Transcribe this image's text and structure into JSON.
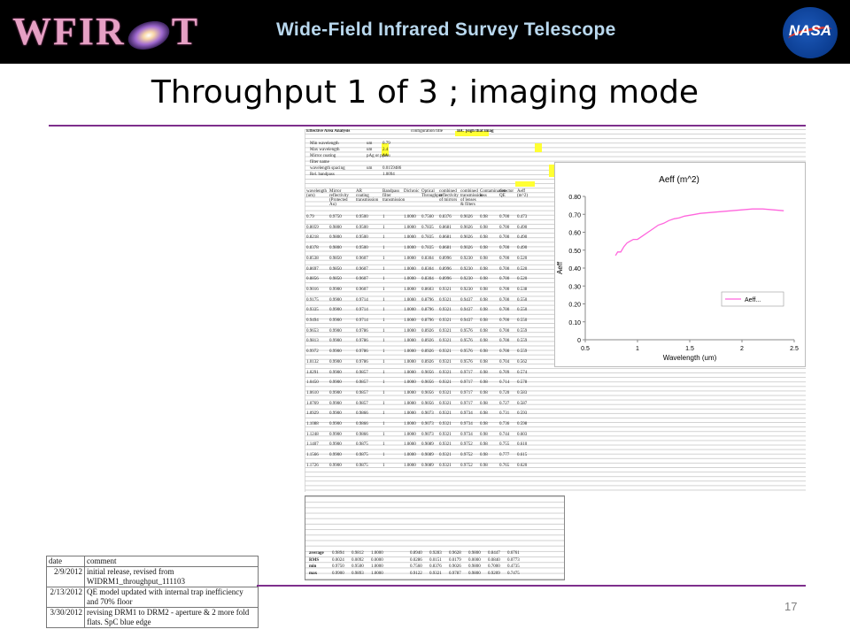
{
  "header": {
    "logo_text": "WFIRST",
    "banner_title": "Wide-Field Infrared Survey Telescope",
    "agency_logo": "NASA"
  },
  "slide": {
    "title": "Throughput 1 of 3 ; imaging mode",
    "page_number": "17"
  },
  "spreadsheet": {
    "sheet_title": "Effective Area Analysis",
    "config_label": "configuration title",
    "config_value": "InC [sigh that imag",
    "param_rows": [
      {
        "label": "Min wavelength",
        "unit": "um",
        "value": "0.79"
      },
      {
        "label": "Max wavelength",
        "unit": "um",
        "value": "2.4"
      },
      {
        "label": "Mirror coating",
        "unit": "pAg or pAu",
        "value": "pAu"
      },
      {
        "label": "filter name",
        "unit": "",
        "value": ""
      },
      {
        "label": "wavelength spacing",
        "unit": "um",
        "value": "0.0159486"
      },
      {
        "label": "Rel. bandpass",
        "unit": "",
        "value": "1.0094"
      }
    ],
    "column_headers": [
      "wavelength (um)",
      "Mirror reflectivity (Protected Au)",
      "AR coating transmission",
      "Bandpass filter transmission",
      "Dichroic",
      "Optical Throughput",
      "combined reflectivity of mirrors",
      "combined transmission of lenses & filters",
      "Contamination loss",
      "detector QE",
      "Aeff (m^2)"
    ],
    "rows": [
      [
        "0.79",
        "0.9750",
        "0.9500",
        "1",
        "1.0000",
        "0.7560",
        "0.8376",
        "0.9026",
        "0.98",
        "0.700",
        "0.473"
      ],
      [
        "0.8059",
        "0.9800",
        "0.9500",
        "1",
        "1.0000",
        "0.7835",
        "0.8681",
        "0.9026",
        "0.98",
        "0.700",
        "0.490"
      ],
      [
        "0.8218",
        "0.9800",
        "0.9500",
        "1",
        "1.0000",
        "0.7835",
        "0.8681",
        "0.9026",
        "0.98",
        "0.700",
        "0.490"
      ],
      [
        "0.8378",
        "0.9800",
        "0.9500",
        "1",
        "1.0000",
        "0.7835",
        "0.8681",
        "0.9026",
        "0.98",
        "0.700",
        "0.490"
      ],
      [
        "0.8538",
        "0.9850",
        "0.9607",
        "1",
        "1.0000",
        "0.8304",
        "0.8996",
        "0.9230",
        "0.98",
        "0.700",
        "0.520"
      ],
      [
        "0.8697",
        "0.9850",
        "0.9607",
        "1",
        "1.0000",
        "0.8304",
        "0.8996",
        "0.9230",
        "0.98",
        "0.700",
        "0.520"
      ],
      [
        "0.8856",
        "0.9850",
        "0.9607",
        "1",
        "1.0000",
        "0.8304",
        "0.8996",
        "0.9230",
        "0.98",
        "0.700",
        "0.520"
      ],
      [
        "0.9016",
        "0.9900",
        "0.9607",
        "1",
        "1.0000",
        "0.8603",
        "0.9321",
        "0.9230",
        "0.98",
        "0.700",
        "0.538"
      ],
      [
        "0.9175",
        "0.9900",
        "0.9714",
        "1",
        "1.0000",
        "0.8796",
        "0.9321",
        "0.9437",
        "0.98",
        "0.700",
        "0.550"
      ],
      [
        "0.9335",
        "0.9900",
        "0.9714",
        "1",
        "1.0000",
        "0.8796",
        "0.9321",
        "0.9437",
        "0.98",
        "0.700",
        "0.550"
      ],
      [
        "0.9494",
        "0.9900",
        "0.9714",
        "1",
        "1.0000",
        "0.8796",
        "0.9321",
        "0.9437",
        "0.98",
        "0.700",
        "0.550"
      ],
      [
        "0.9653",
        "0.9900",
        "0.9786",
        "1",
        "1.0000",
        "0.8926",
        "0.9321",
        "0.9576",
        "0.98",
        "0.700",
        "0.559"
      ],
      [
        "0.9813",
        "0.9900",
        "0.9786",
        "1",
        "1.0000",
        "0.8926",
        "0.9321",
        "0.9576",
        "0.98",
        "0.700",
        "0.559"
      ],
      [
        "0.9972",
        "0.9900",
        "0.9786",
        "1",
        "1.0000",
        "0.8926",
        "0.9321",
        "0.9576",
        "0.98",
        "0.700",
        "0.559"
      ],
      [
        "1.0132",
        "0.9900",
        "0.9786",
        "1",
        "1.0000",
        "0.8926",
        "0.9321",
        "0.9576",
        "0.98",
        "0.704",
        "0.562"
      ],
      [
        "1.0291",
        "0.9900",
        "0.9857",
        "1",
        "1.0000",
        "0.9056",
        "0.9321",
        "0.9717",
        "0.98",
        "0.709",
        "0.574"
      ],
      [
        "1.0450",
        "0.9900",
        "0.9857",
        "1",
        "1.0000",
        "0.9056",
        "0.9321",
        "0.9717",
        "0.98",
        "0.714",
        "0.578"
      ],
      [
        "1.0610",
        "0.9900",
        "0.9857",
        "1",
        "1.0000",
        "0.9056",
        "0.9321",
        "0.9717",
        "0.98",
        "0.720",
        "0.583"
      ],
      [
        "1.0769",
        "0.9900",
        "0.9857",
        "1",
        "1.0000",
        "0.9056",
        "0.9321",
        "0.9717",
        "0.98",
        "0.727",
        "0.587"
      ],
      [
        "1.0929",
        "0.9900",
        "0.9866",
        "1",
        "1.0000",
        "0.9073",
        "0.9321",
        "0.9734",
        "0.98",
        "0.731",
        "0.593"
      ],
      [
        "1.1088",
        "0.9900",
        "0.9866",
        "1",
        "1.0000",
        "0.9073",
        "0.9321",
        "0.9734",
        "0.98",
        "0.736",
        "0.598"
      ],
      [
        "1.1248",
        "0.9900",
        "0.9866",
        "1",
        "1.0000",
        "0.9073",
        "0.9321",
        "0.9734",
        "0.98",
        "0.744",
        "0.603"
      ],
      [
        "1.1407",
        "0.9900",
        "0.9875",
        "1",
        "1.0000",
        "0.9089",
        "0.9321",
        "0.9752",
        "0.98",
        "0.755",
        "0.610"
      ],
      [
        "1.1566",
        "0.9900",
        "0.9875",
        "1",
        "1.0000",
        "0.9089",
        "0.9321",
        "0.9752",
        "0.98",
        "0.777",
        "0.615"
      ],
      [
        "1.1726",
        "0.9900",
        "0.9875",
        "1",
        "1.0000",
        "0.9089",
        "0.9321",
        "0.9752",
        "0.98",
        "0.765",
        "0.620"
      ]
    ],
    "summary_rows": [
      {
        "label": "average",
        "values": [
          "0.9894",
          "0.9812",
          "1.0000",
          "",
          "0.8940",
          "0.9283",
          "0.9628",
          "0.9800",
          "0.8447",
          "0.6761"
        ]
      },
      {
        "label": "RMS",
        "values": [
          "0.0024",
          "0.0092",
          "0.0000",
          "",
          "0.0286",
          "0.0151",
          "0.0179",
          "0.0000",
          "0.0840",
          "0.0773"
        ]
      },
      {
        "label": "min",
        "values": [
          "0.9750",
          "0.9500",
          "1.0000",
          "",
          "0.7560",
          "0.8376",
          "0.9026",
          "0.9800",
          "0.7000",
          "0.4735"
        ]
      },
      {
        "label": "max",
        "values": [
          "0.9900",
          "0.9893",
          "1.0000",
          "",
          "0.9122",
          "0.9321",
          "0.9787",
          "0.9800",
          "0.9209",
          "0.7475"
        ]
      }
    ]
  },
  "chart_data": {
    "type": "line",
    "title": "Aeff  (m^2)",
    "xlabel": "Wavelength (um)",
    "ylabel": "Aeff",
    "xlim": [
      0.5,
      2.5
    ],
    "ylim": [
      0,
      0.8
    ],
    "xticks": [
      "0.5",
      "1",
      "1.5",
      "2",
      "2.5"
    ],
    "yticks": [
      "0",
      "0.10",
      "0.20",
      "0.30",
      "0.40",
      "0.50",
      "0.60",
      "0.70",
      "0.80"
    ],
    "legend": "top-right",
    "series": [
      {
        "name": "Aeff...",
        "color": "#ff66dd",
        "x": [
          0.79,
          0.81,
          0.84,
          0.87,
          0.9,
          0.93,
          0.96,
          1.0,
          1.05,
          1.1,
          1.15,
          1.2,
          1.25,
          1.3,
          1.35,
          1.4,
          1.45,
          1.5,
          1.55,
          1.6,
          1.7,
          1.8,
          1.9,
          2.0,
          2.1,
          2.2,
          2.3,
          2.4
        ],
        "y": [
          0.47,
          0.49,
          0.49,
          0.52,
          0.54,
          0.55,
          0.56,
          0.56,
          0.58,
          0.6,
          0.62,
          0.64,
          0.65,
          0.665,
          0.675,
          0.68,
          0.69,
          0.695,
          0.7,
          0.705,
          0.71,
          0.715,
          0.72,
          0.725,
          0.73,
          0.73,
          0.725,
          0.72
        ]
      }
    ]
  },
  "comment_table": {
    "headers": [
      "date",
      "comment"
    ],
    "rows": [
      {
        "date": "2/9/2012",
        "comment": "initial release, revised from WIDRM1_throughput_111103"
      },
      {
        "date": "2/13/2012",
        "comment": "QE model updated with internal trap inefficiency and 70% floor"
      },
      {
        "date": "3/30/2012",
        "comment": "revising DRM1 to DRM2 - aperture & 2 more fold flats. SpC blue edge"
      }
    ]
  }
}
